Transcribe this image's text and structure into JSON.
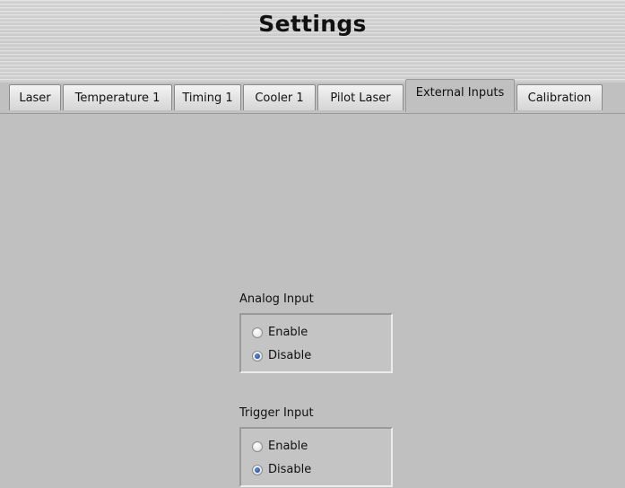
{
  "header": {
    "title": "Settings"
  },
  "tabs": [
    {
      "label": "Laser",
      "active": false
    },
    {
      "label": "Temperature 1",
      "active": false
    },
    {
      "label": "Timing 1",
      "active": false
    },
    {
      "label": "Cooler 1",
      "active": false
    },
    {
      "label": "Pilot Laser",
      "active": false
    },
    {
      "label": "External Inputs",
      "active": true
    },
    {
      "label": "Calibration",
      "active": false
    }
  ],
  "external_inputs": {
    "analog_input": {
      "label": "Analog Input",
      "options": [
        {
          "label": "Enable",
          "selected": false
        },
        {
          "label": "Disable",
          "selected": true
        }
      ]
    },
    "trigger_input": {
      "label": "Trigger Input",
      "options": [
        {
          "label": "Enable",
          "selected": false
        },
        {
          "label": "Disable",
          "selected": true
        }
      ]
    }
  },
  "colors": {
    "background": "#c0c0c0",
    "radio_selected": "#2a5bb2"
  }
}
